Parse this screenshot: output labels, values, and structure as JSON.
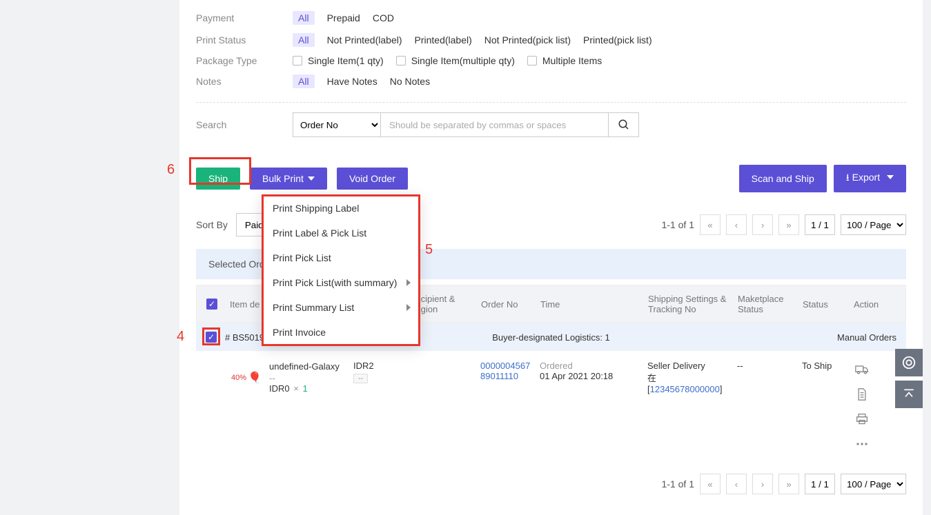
{
  "filters": {
    "payment": {
      "label": "Payment",
      "options": [
        "All",
        "Prepaid",
        "COD"
      ],
      "active": "All"
    },
    "printStatus": {
      "label": "Print Status",
      "options": [
        "All",
        "Not Printed(label)",
        "Printed(label)",
        "Not Printed(pick list)",
        "Printed(pick list)"
      ],
      "active": "All"
    },
    "packageType": {
      "label": "Package Type",
      "options": [
        "Single Item(1 qty)",
        "Single Item(multiple qty)",
        "Multiple Items"
      ]
    },
    "notes": {
      "label": "Notes",
      "options": [
        "All",
        "Have Notes",
        "No Notes"
      ],
      "active": "All"
    },
    "search": {
      "label": "Search",
      "selected": "Order No",
      "placeholder": "Should be separated by commas or spaces"
    }
  },
  "actions": {
    "ship": "Ship",
    "bulkPrint": "Bulk Print",
    "voidOrder": "Void Order",
    "scanAndShip": "Scan and Ship",
    "export": "Export"
  },
  "bulkPrintMenu": [
    "Print Shipping Label",
    "Print Label & Pick List",
    "Print Pick List",
    "Print Pick List(with summary)",
    "Print Summary List",
    "Print Invoice"
  ],
  "sort": {
    "label": "Sort By",
    "value": "Paid"
  },
  "pagination": {
    "rangeText": "1-1 of 1",
    "pageField": "1 / 1",
    "perPage": "100 / Page"
  },
  "selectedBar": "Selected Ord",
  "columns": {
    "item": "Item de",
    "recipient": "Recipient & Region",
    "orderNo": "Order No",
    "time": "Time",
    "shipping": "Shipping Settings & Tracking No",
    "marketplace": "Maketplace Status",
    "status": "Status",
    "action": "Action"
  },
  "group": {
    "code": "# BS5019983",
    "center": "Buyer-designated Logistics: 1",
    "right": "Manual Orders"
  },
  "row": {
    "thumb": "40%",
    "title": "undefined-Galaxy",
    "sub": "--",
    "price": "IDR0",
    "times": "×",
    "qty": "1",
    "sn": "IDR2",
    "snTag": "--",
    "orderNo": "000000456789011110",
    "orderedLabel": "Ordered",
    "time": "01 Apr 2021 20:18",
    "shipMethod": "Seller Delivery",
    "shipLocale": "在",
    "tracking": "12345678000000",
    "marketplace": "--",
    "status": "To Ship"
  },
  "annotations": {
    "n4": "4",
    "n5": "5",
    "n6": "6"
  }
}
